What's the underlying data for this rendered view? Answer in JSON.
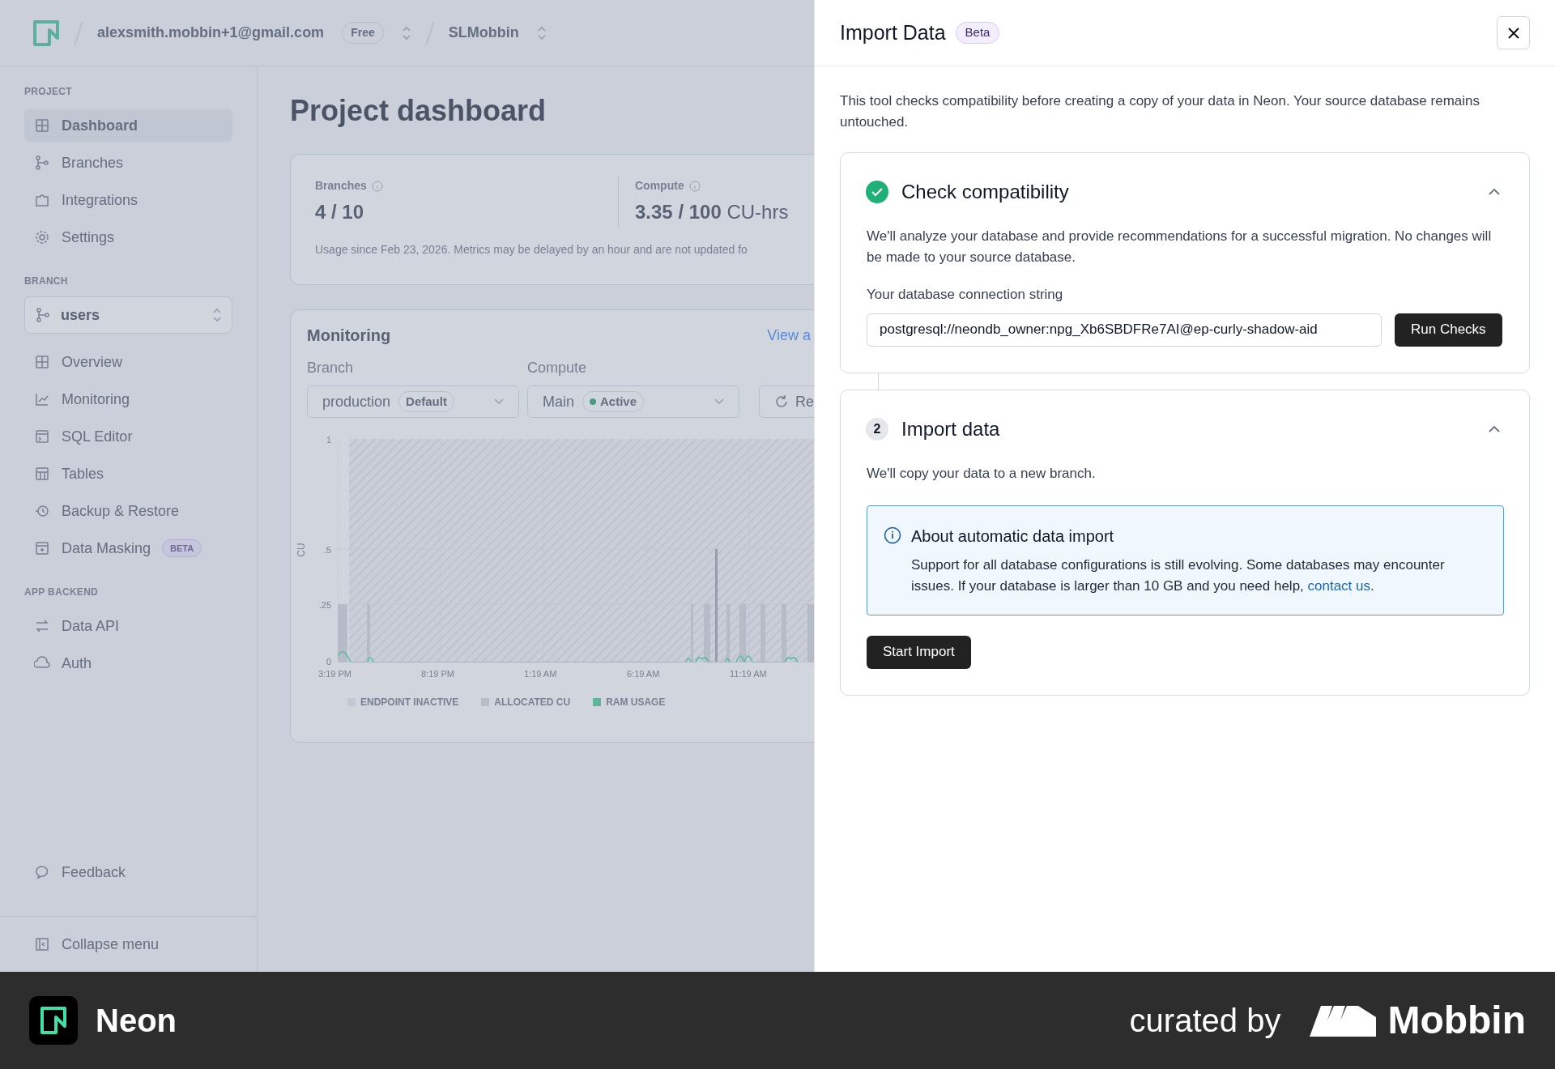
{
  "header": {
    "account": "alexsmith.mobbin+1@gmail.com",
    "plan": "Free",
    "project": "SLMobbin"
  },
  "sidebar": {
    "sections": [
      {
        "title": "PROJECT",
        "items": [
          {
            "label": "Dashboard",
            "selected": true
          },
          {
            "label": "Branches",
            "selected": false
          },
          {
            "label": "Integrations",
            "selected": false
          },
          {
            "label": "Settings",
            "selected": false
          }
        ]
      },
      {
        "title": "BRANCH",
        "branch": "users",
        "items": [
          {
            "label": "Overview",
            "selected": false
          },
          {
            "label": "Monitoring",
            "selected": false
          },
          {
            "label": "SQL Editor",
            "selected": false
          },
          {
            "label": "Tables",
            "selected": false
          },
          {
            "label": "Backup & Restore",
            "selected": false
          },
          {
            "label": "Data Masking",
            "badge": "BETA",
            "selected": false
          }
        ]
      },
      {
        "title": "APP BACKEND",
        "items": [
          {
            "label": "Data API",
            "selected": false
          },
          {
            "label": "Auth",
            "selected": false
          }
        ]
      }
    ],
    "feedback": "Feedback",
    "collapse": "Collapse menu"
  },
  "page": {
    "title": "Project dashboard",
    "stats": [
      {
        "label": "Branches",
        "value": "4 / 10"
      },
      {
        "label": "Compute",
        "value": "3.35 / 100",
        "unit": "CU-hrs"
      }
    ],
    "usage_note": "Usage since Feb 23, 2026. Metrics may be delayed by an hour and are not updated fo",
    "monitoring": {
      "title": "Monitoring",
      "link": "View a",
      "branch_label": "Branch",
      "branch": "production",
      "branch_tag": "Default",
      "compute_label": "Compute",
      "compute": "Main",
      "compute_status": "Active",
      "refresh": "Re",
      "y_axis": "CU",
      "yticks": [
        "1",
        ".5",
        ".25",
        "0"
      ],
      "xticks": [
        "3:19 PM",
        "8:19 PM",
        "1:19 AM",
        "6:19 AM",
        "11:19 AM"
      ],
      "legend": [
        {
          "label": "ENDPOINT INACTIVE",
          "color": "#c4c8d2"
        },
        {
          "label": "ALLOCATED CU",
          "color": "#b8bcc6"
        },
        {
          "label": "RAM USAGE",
          "color": "#5fb79a"
        }
      ]
    }
  },
  "dialog": {
    "title": "Import Data",
    "badge": "Beta",
    "intro": "This tool checks compatibility before creating a copy of your data in Neon. Your source database remains untouched.",
    "steps": [
      {
        "kind": "check",
        "title": "Check compatibility",
        "done": true,
        "expanded": true,
        "text": "We'll analyze your database and provide recommendations for a successful migration. No changes will be made to your source database.",
        "field_label": "Your database connection string",
        "field_value": "postgresql://neondb_owner:npg_Xb6SBDFRe7AI@ep-curly-shadow-aid",
        "button": "Run Checks"
      },
      {
        "kind": "import",
        "number": "2",
        "title": "Import data",
        "done": false,
        "expanded": true,
        "text": "We'll copy your data to a new branch.",
        "notice_title": "About automatic data import",
        "notice_text": "Support for all database configurations is still evolving. Some databases may encounter issues. If your database is larger than 10 GB and you need help, ",
        "notice_link": "contact us",
        "notice_end": ".",
        "button": "Start Import"
      }
    ]
  },
  "footer": {
    "brand": "Neon",
    "curated": "curated by",
    "curator": "Mobbin"
  }
}
